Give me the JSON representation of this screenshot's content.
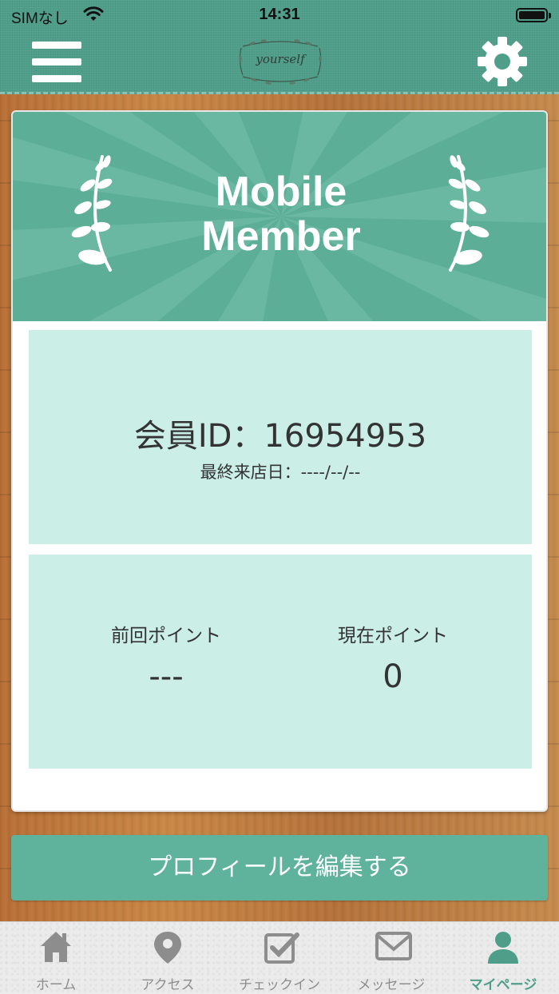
{
  "status_bar": {
    "carrier": "SIMなし",
    "time": "14:31",
    "wifi_icon": "wifi-icon",
    "battery_icon": "battery-icon"
  },
  "header": {
    "menu_icon": "hamburger-menu-icon",
    "settings_icon": "gear-icon",
    "logo_text": "yourself"
  },
  "banner": {
    "title_line1": "Mobile",
    "title_line2": "Member",
    "left_icon": "laurel-icon",
    "right_icon": "laurel-icon"
  },
  "member_info": {
    "member_id": "会員ID：16954953",
    "last_visit": "最終来店日：----/--/--"
  },
  "points": {
    "previous_label": "前回ポイント",
    "previous_value": "---",
    "current_label": "現在ポイント",
    "current_value": "0"
  },
  "actions": {
    "edit_profile_label": "プロフィールを編集する"
  },
  "tabbar": {
    "tabs": [
      {
        "label": "ホーム",
        "icon": "home-icon",
        "active": false
      },
      {
        "label": "アクセス",
        "icon": "map-pin-icon",
        "active": false
      },
      {
        "label": "チェックイン",
        "icon": "checkbox-icon",
        "active": false
      },
      {
        "label": "メッセージ",
        "icon": "envelope-icon",
        "active": false
      },
      {
        "label": "マイページ",
        "icon": "user-icon",
        "active": true
      }
    ]
  },
  "colors": {
    "theme_green": "#5cae97",
    "panel_mint": "#cbeee6",
    "active_tab": "#4f9e8a"
  }
}
